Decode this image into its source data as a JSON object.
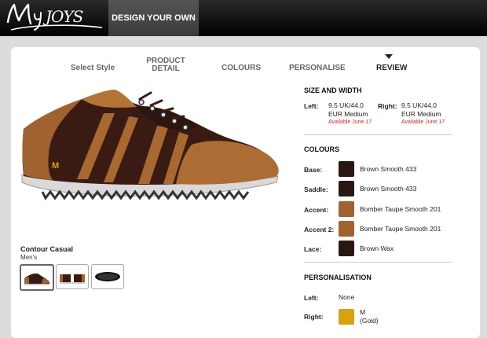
{
  "header": {
    "logo": "MyJoys",
    "design_tab": "DESIGN YOUR OWN"
  },
  "steps": [
    "Select Style",
    "PRODUCT DETAIL",
    "COLOURS",
    "PERSONALISE",
    "REVIEW"
  ],
  "active_step": "REVIEW",
  "product": {
    "name": "Contour Casual",
    "gender": "Men's",
    "monogram": "M"
  },
  "size_width": {
    "title": "SIZE AND WIDTH",
    "left_label": "Left:",
    "left_size": "9.5 UK/44.0",
    "left_width": "EUR Medium",
    "left_availability": "Available June 17",
    "right_label": "Right:",
    "right_size": "9.5 UK/44.0",
    "right_width": "EUR Medium",
    "right_availability": "Available June 17"
  },
  "colours": {
    "title": "COLOURS",
    "items": [
      {
        "label": "Base:",
        "name": "Brown Smooth 433",
        "color": "#2a1712"
      },
      {
        "label": "Saddle:",
        "name": "Brown Smooth 433",
        "color": "#2a1712"
      },
      {
        "label": "Accent:",
        "name": "Bomber Taupe Smooth 201",
        "color": "#a0622e"
      },
      {
        "label": "Accent 2:",
        "name": "Bomber Taupe Smooth 201",
        "color": "#a0622e"
      },
      {
        "label": "Lace:",
        "name": "Brown Wax",
        "color": "#2a1712"
      }
    ]
  },
  "personalisation": {
    "title": "PERSONALISATION",
    "left_label": "Left:",
    "left_value": "None",
    "right_label": "Right:",
    "right_value": "M",
    "right_color_name": "(Gold)",
    "right_color": "#d8a20c"
  }
}
